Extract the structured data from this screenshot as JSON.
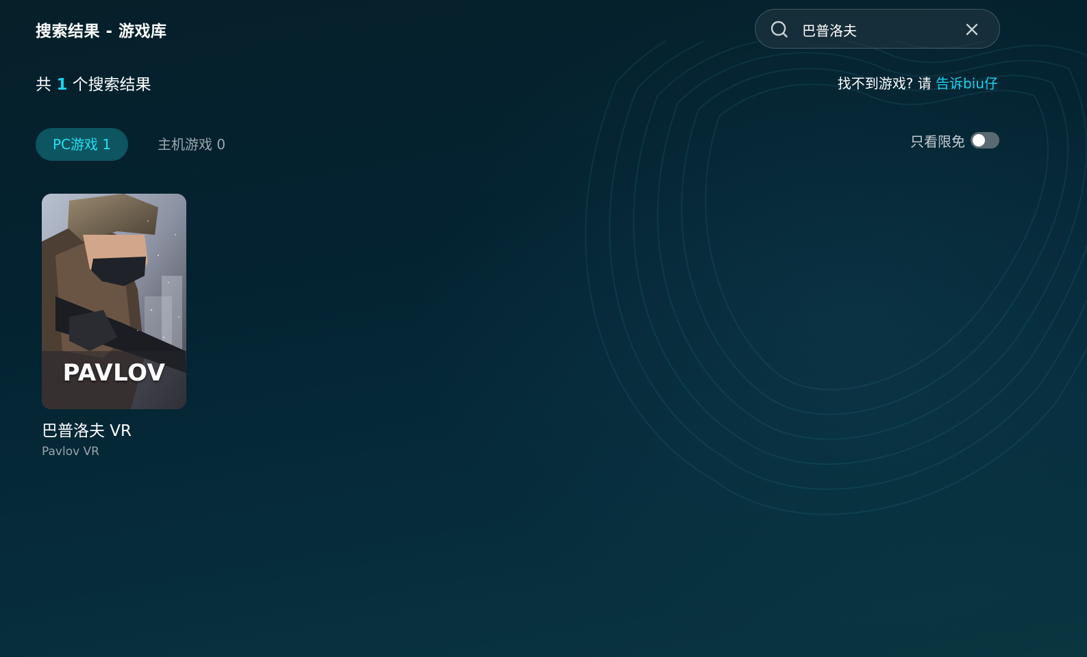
{
  "header": {
    "title": "搜索结果 - 游戏库"
  },
  "search": {
    "value": "巴普洛夫",
    "search_icon": "search-icon",
    "clear_icon": "close-icon"
  },
  "results": {
    "prefix": "共 ",
    "count": "1",
    "suffix": " 个搜索结果"
  },
  "feedback": {
    "text": "找不到游戏? 请 ",
    "link": "告诉biu仔"
  },
  "tabs": [
    {
      "label": "PC游戏 1",
      "active": true
    },
    {
      "label": "主机游戏 0",
      "active": false
    }
  ],
  "filter": {
    "label": "只看限免",
    "enabled": false
  },
  "games": [
    {
      "cover_text": "PAVLOV",
      "name_cn": "巴普洛夫 VR",
      "name_en": "Pavlov VR"
    }
  ],
  "colors": {
    "accent": "#19d4ee",
    "tab_active_bg": "#0d5560",
    "background": "#042230"
  }
}
